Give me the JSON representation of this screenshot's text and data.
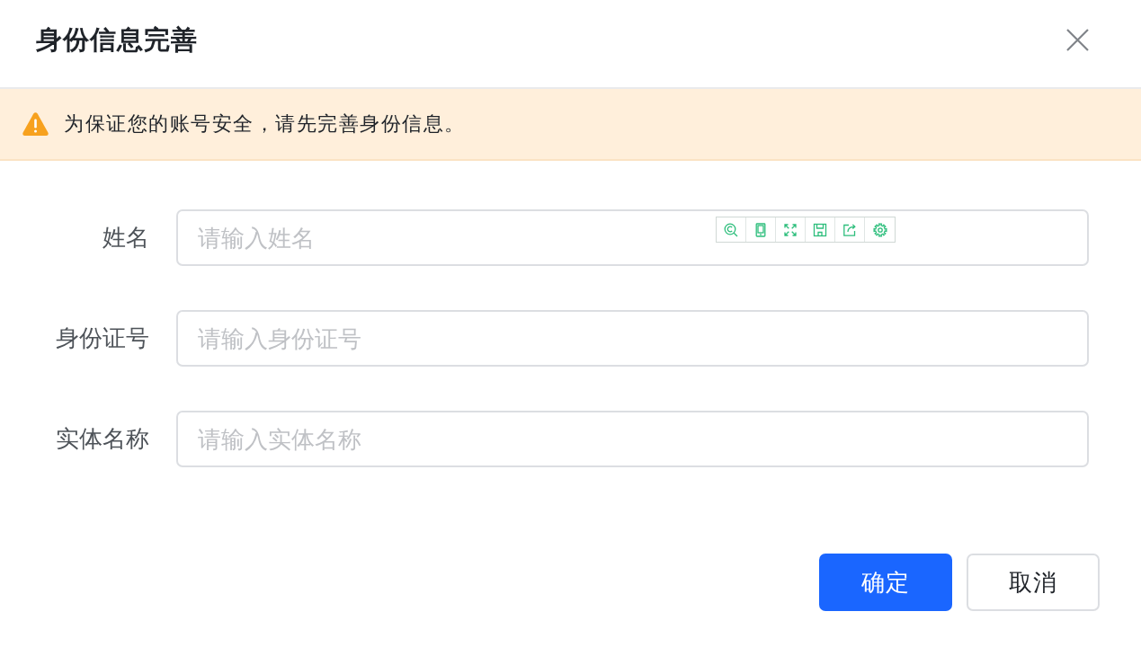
{
  "dialog": {
    "title": "身份信息完善"
  },
  "alert": {
    "kind": "warning",
    "message": "为保证您的账号安全，请先完善身份信息。"
  },
  "form": {
    "fields": [
      {
        "label": "姓名",
        "placeholder": "请输入姓名",
        "toolbar": true
      },
      {
        "label": "身份证号",
        "placeholder": "请输入身份证号",
        "toolbar": false
      },
      {
        "label": "实体名称",
        "placeholder": "请输入实体名称",
        "toolbar": false
      }
    ]
  },
  "buttons": [
    {
      "label": "确定",
      "kind": "primary"
    },
    {
      "label": "取消",
      "kind": "default"
    }
  ]
}
